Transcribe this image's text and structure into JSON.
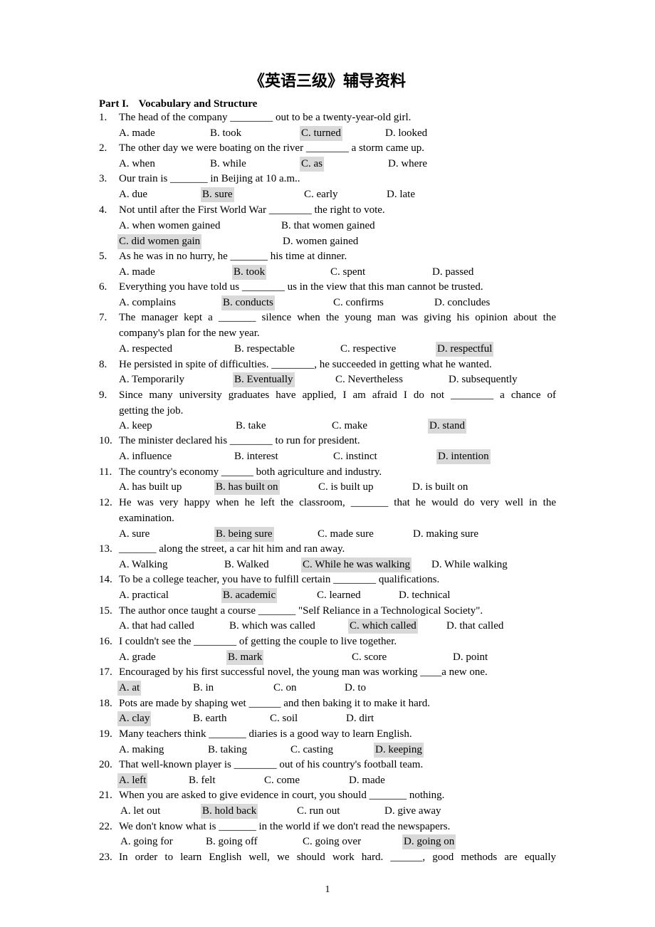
{
  "document": {
    "title": "《英语三级》辅导资料",
    "part_label": "Part I.",
    "part_title": "Vocabulary and Structure",
    "page_number": "1",
    "highlight_color": "#d9d9d9"
  },
  "questions": [
    {
      "num": "1.",
      "stem": [
        "The head of the company ________ out to be a twenty-year-old girl."
      ],
      "options": [
        "A. made",
        "B. took",
        "C. turned",
        "D. looked"
      ],
      "answer": 2
    },
    {
      "num": "2.",
      "stem": [
        "The other day we were boating on the river ________ a storm came up."
      ],
      "options": [
        "A. when",
        "B. while",
        "C. as",
        "D. where"
      ],
      "answer": 2
    },
    {
      "num": "3.",
      "stem": [
        "Our train is _______ in Beijing at 10 a.m.."
      ],
      "options": [
        "A. due",
        "B. sure",
        "C. early",
        "D. late"
      ],
      "answer": 1
    },
    {
      "num": "4.",
      "stem": [
        "Not until after the First World War ________ the right to vote."
      ],
      "options": [
        "A. when women gained",
        "B. that women gained",
        "C. did women gain",
        "D. women gained"
      ],
      "answer": 2
    },
    {
      "num": "5.",
      "stem": [
        "As he was in no hurry, he _______ his time at dinner."
      ],
      "options": [
        "A. made",
        "B. took",
        "C. spent",
        "D. passed"
      ],
      "answer": 1
    },
    {
      "num": "6.",
      "stem": [
        "Everything you have told us ________ us in the view that this man cannot be trusted."
      ],
      "options": [
        "A. complains",
        "B. conducts",
        "C. confirms",
        "D. concludes"
      ],
      "answer": 1
    },
    {
      "num": "7.",
      "stem": [
        "The manager kept a _______ silence when the young man was giving his opinion about the",
        "company's plan for the new year."
      ],
      "options": [
        "A. respected",
        "B. respectable",
        "C. respective",
        "D. respectful"
      ],
      "answer": 3
    },
    {
      "num": "8.",
      "stem": [
        "He persisted in spite of difficulties. ________, he succeeded in getting what he wanted."
      ],
      "options": [
        "A. Temporarily",
        "B. Eventually",
        "C. Nevertheless",
        "D. subsequently"
      ],
      "answer": 1
    },
    {
      "num": "9.",
      "stem": [
        "Since many university graduates have applied, I am afraid I do not ________ a chance of",
        "getting the job."
      ],
      "options": [
        "A. keep",
        "B. take",
        "C. make",
        "D. stand"
      ],
      "answer": 3
    },
    {
      "num": "10.",
      "stem": [
        "The minister declared his ________ to run for president."
      ],
      "options": [
        "A. influence",
        "B. interest",
        "C. instinct",
        "D. intention"
      ],
      "answer": 3
    },
    {
      "num": "11.",
      "stem": [
        "The country's economy ______ both agriculture and industry."
      ],
      "options": [
        "A. has built up",
        "B. has built on",
        "C. is built up",
        "D. is built on"
      ],
      "answer": 1
    },
    {
      "num": "12.",
      "stem": [
        "He was very happy when he left the classroom, _______ that he would do very well in the",
        "examination."
      ],
      "options": [
        "A. sure",
        "B. being sure",
        "C. made sure",
        "D. making sure"
      ],
      "answer": 1
    },
    {
      "num": "13.",
      "stem": [
        "_______ along the street, a car hit him and ran away."
      ],
      "options": [
        "A. Walking",
        "B. Walked",
        "C. While he was walking",
        "D. While walking"
      ],
      "answer": 2
    },
    {
      "num": "14.",
      "stem": [
        "To be a college teacher, you have to fulfill certain ________ qualifications."
      ],
      "options": [
        "A. practical",
        "B. academic",
        "C. learned",
        "D. technical"
      ],
      "answer": 1
    },
    {
      "num": "15.",
      "stem": [
        "The author once taught a course _______ \"Self Reliance in a Technological Society\"."
      ],
      "options": [
        "A. that had called",
        "B. which was called",
        "C. which called",
        "D. that called"
      ],
      "answer": 2
    },
    {
      "num": "16.",
      "stem": [
        "I couldn't see the ________ of getting the couple to live together."
      ],
      "options": [
        "A. grade",
        "B. mark",
        "C. score",
        "D. point"
      ],
      "answer": 1
    },
    {
      "num": "17.",
      "stem": [
        "Encouraged by his first successful novel, the young man was working ____a new one."
      ],
      "options": [
        "A. at",
        "B. in",
        "C. on",
        "D. to"
      ],
      "answer": 0
    },
    {
      "num": "18.",
      "stem": [
        "Pots are made by shaping wet ______ and then baking it to make it hard."
      ],
      "options": [
        "A. clay",
        "B. earth",
        "C. soil",
        "D. dirt"
      ],
      "answer": 0
    },
    {
      "num": "19.",
      "stem": [
        "Many teachers think _______ diaries is a good way to learn English."
      ],
      "options": [
        "A. making",
        "B. taking",
        "C. casting",
        "D. keeping"
      ],
      "answer": 3
    },
    {
      "num": "20.",
      "stem": [
        "That well-known player is ________ out of his country's football team."
      ],
      "options": [
        "A. left",
        "B. felt",
        "C. come",
        "D. made"
      ],
      "answer": 0
    },
    {
      "num": "21.",
      "stem": [
        "When you are asked to give evidence in court, you should _______ nothing."
      ],
      "options": [
        "A. let out",
        "B. hold back",
        "C. run out",
        "D. give away"
      ],
      "answer": 1
    },
    {
      "num": "22.",
      "stem": [
        "We don't know what is _______ in the world if we don't read the newspapers."
      ],
      "options": [
        "A. going for",
        "B. going off",
        "C. going over",
        "D. going on"
      ],
      "answer": 3
    },
    {
      "num": "23.",
      "stem": [
        "In order to learn English well, we should work hard. ______, good methods are equally"
      ],
      "options": [],
      "answer": null
    }
  ]
}
